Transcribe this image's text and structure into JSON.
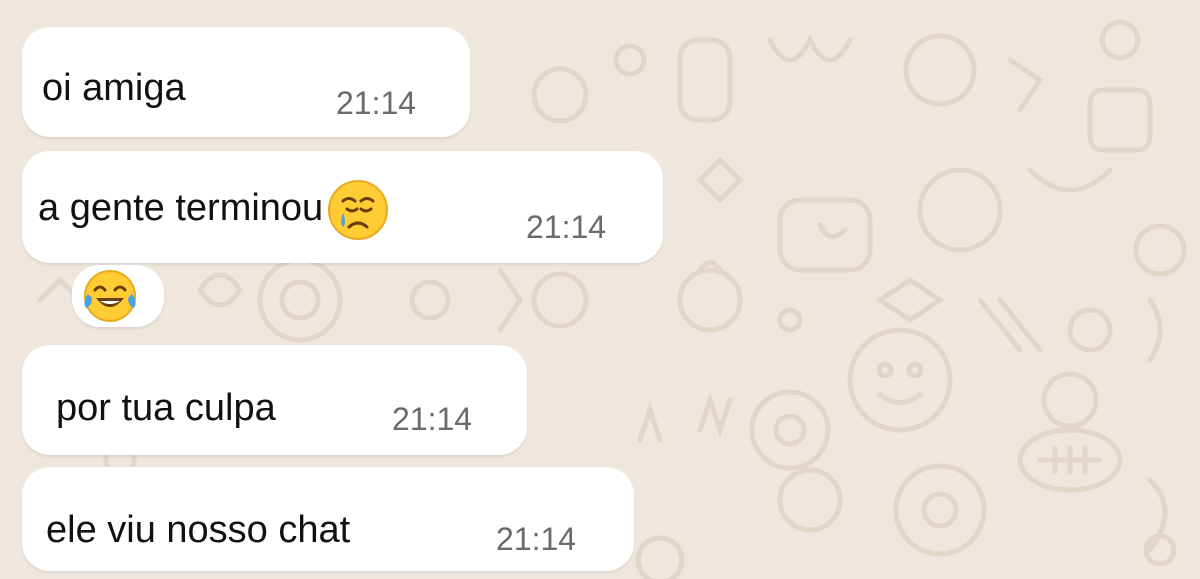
{
  "messages": [
    {
      "text": "oi amiga",
      "time": "21:14",
      "emoji": ""
    },
    {
      "text": "a gente terminou",
      "time": "21:14",
      "emoji": "crying-face-icon"
    },
    {
      "text": "",
      "time": "",
      "emoji": "tears-of-joy-icon"
    },
    {
      "text": "por tua culpa",
      "time": "21:14",
      "emoji": ""
    },
    {
      "text": "ele viu nosso chat",
      "time": "21:14",
      "emoji": ""
    }
  ],
  "colors": {
    "wallpaper": "#efe7dd",
    "doodle": "#e2d6c8",
    "bubble": "#ffffff",
    "text": "#111111",
    "time": "#6b6b6b",
    "emoji_face": "#ffcc33",
    "emoji_tear": "#4aa3df"
  }
}
